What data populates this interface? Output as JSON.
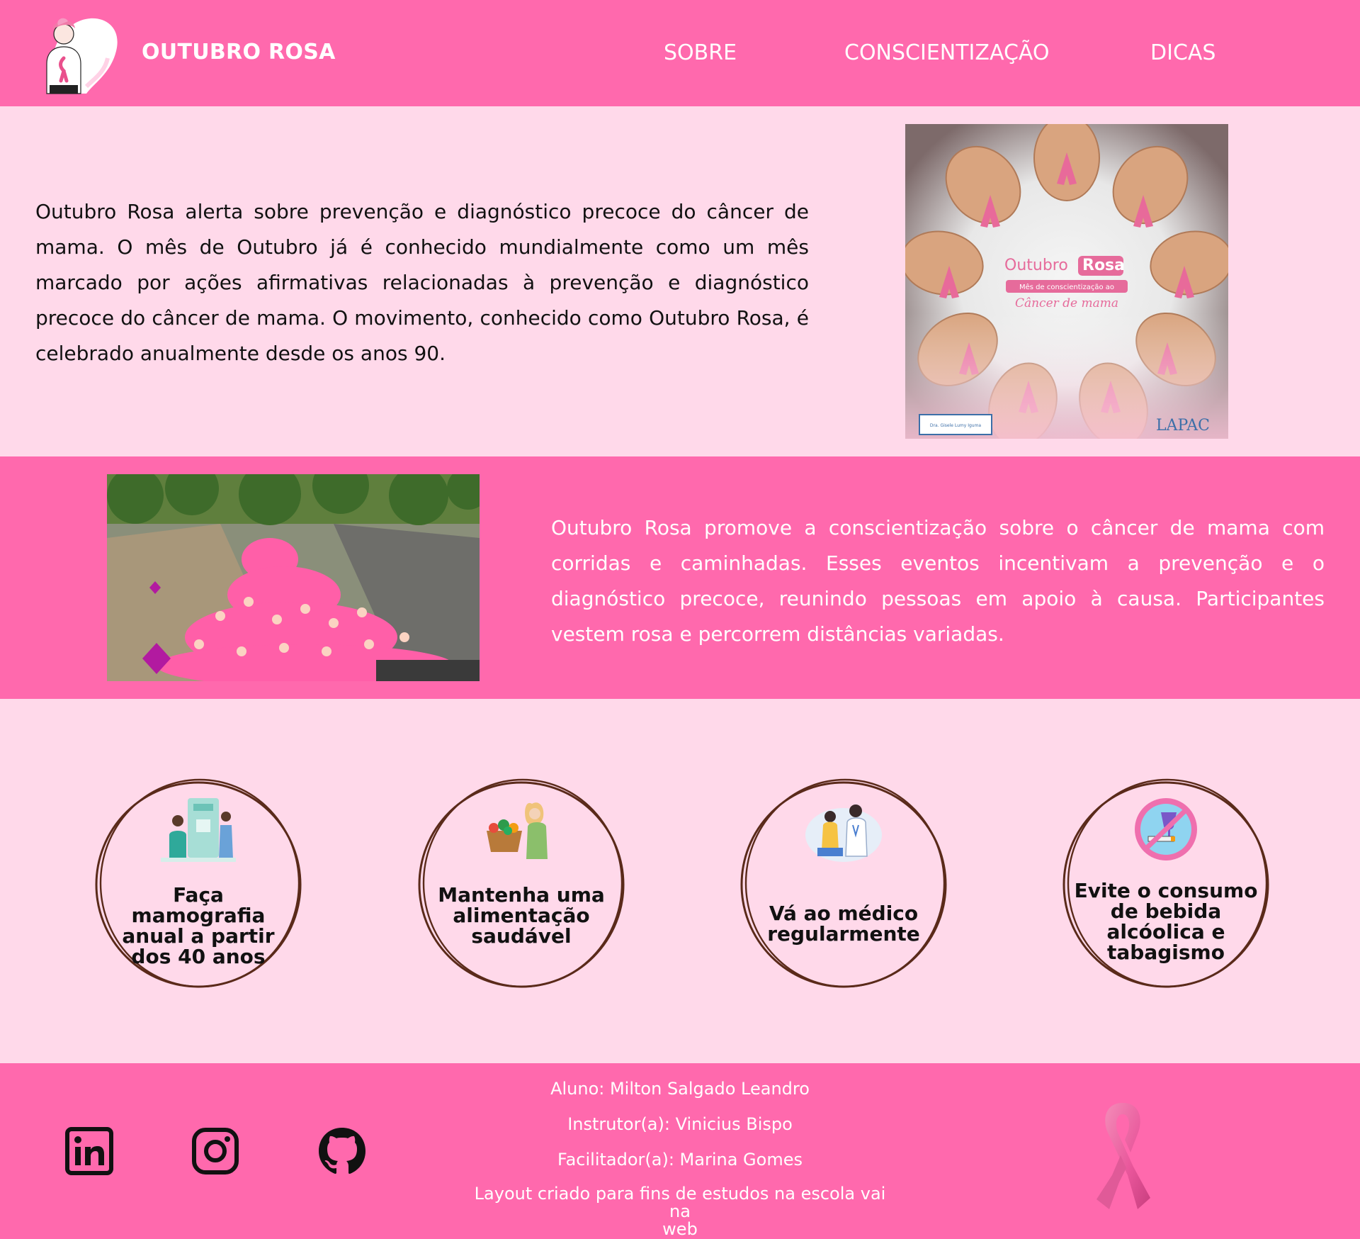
{
  "header": {
    "brand": "OUTUBRO ROSA",
    "nav": [
      {
        "label": "SOBRE"
      },
      {
        "label": "CONSCIENTIZAÇÃO"
      },
      {
        "label": "DICAS"
      }
    ]
  },
  "about": {
    "text": "Outubro Rosa alerta sobre prevenção e diagnóstico precoce do câncer de mama. O mês de Outubro já é conhecido mundialmente como um mês marcado por ações afirmativas relacionadas à prevenção e diagnóstico precoce do câncer de mama. O movimento, conhecido como Outubro Rosa, é celebrado anualmente desde os anos 90.",
    "image": {
      "title_a": "Outubro",
      "title_b": "Rosa",
      "subtitle": "Mês de conscientização ao",
      "script": "Câncer de mama",
      "badge": "Dra. Gisele Lumy Iguma",
      "logo": "LAPAC"
    }
  },
  "awareness": {
    "text": "Outubro Rosa promove a conscientização sobre o câncer de mama com corridas e caminhadas. Esses eventos incentivam a prevenção e o diagnóstico precoce, reunindo pessoas em apoio à causa. Participantes vestem rosa e percorrem distâncias variadas."
  },
  "tips": [
    {
      "icon": "mammography-icon",
      "lines": [
        "Faça mamografia",
        "anual a partir",
        "dos 40 anos"
      ]
    },
    {
      "icon": "healthy-food-icon",
      "lines": [
        "Mantenha uma",
        "alimentação",
        "saudável"
      ]
    },
    {
      "icon": "doctor-visit-icon",
      "lines": [
        "Vá ao médico",
        "regularmente"
      ]
    },
    {
      "icon": "no-alcohol-smoking-icon",
      "lines": [
        "Evite o consumo",
        "de bebida",
        "alcóolica e",
        "tabagismo"
      ]
    }
  ],
  "footer": {
    "student": "Aluno: Milton Salgado Leandro",
    "instructor": "Instrutor(a): Vinicius Bispo",
    "facilitator": "Facilitador(a): Marina Gomes",
    "note_1": "Layout criado para fins de estudos na escola vai na",
    "note_2": "web",
    "social": [
      "linkedin-icon",
      "instagram-icon",
      "github-icon"
    ]
  },
  "colors": {
    "primary_pink": "#ff69ad",
    "light_pink": "#ffd9ea",
    "ring_brown": "#5a2a1a"
  }
}
